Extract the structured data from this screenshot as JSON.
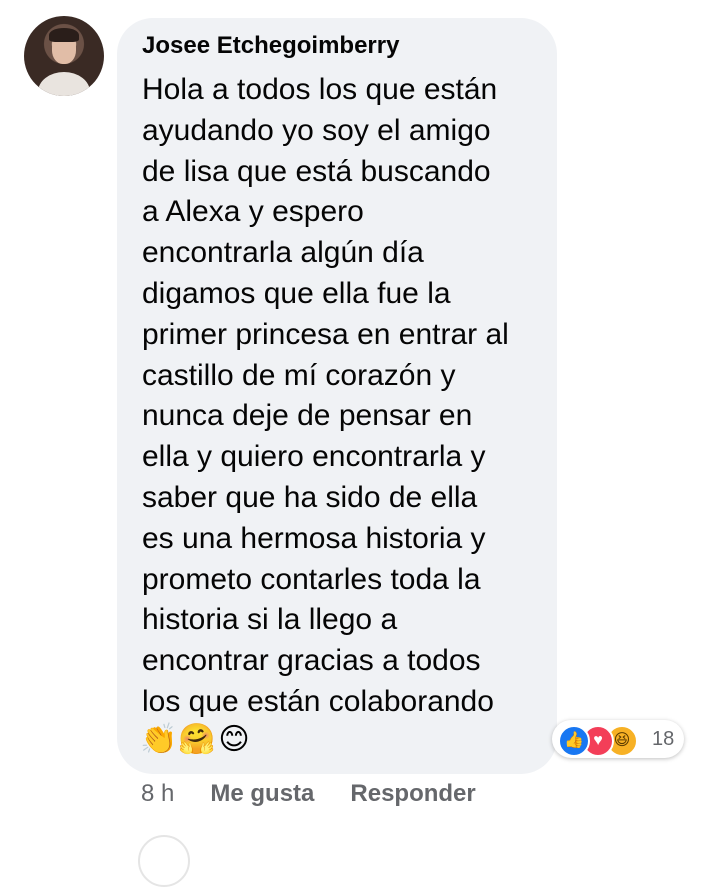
{
  "comment": {
    "author": "Josee Etchegoimberry",
    "lines": [
      "Hola a todos los que están",
      "ayudando yo soy el amigo",
      "de lisa que está buscando",
      "a Alexa y espero",
      "encontrarla algún día",
      "digamos que ella fue la",
      "primer princesa en entrar al",
      "castillo de mí corazón y",
      "nunca deje de pensar en",
      "ella y quiero encontrarla y",
      "saber que ha sido de ella",
      "es una hermosa historia y",
      "prometo contarles toda la",
      "historia si la llego a",
      "encontrar gracias a todos",
      "los que están colaborando"
    ],
    "emojis": [
      "👏",
      "🤗",
      "😊"
    ]
  },
  "reactions": {
    "icons": [
      "like",
      "love",
      "haha"
    ],
    "count": "18"
  },
  "actions": {
    "time": "8 h",
    "like": "Me gusta",
    "reply": "Responder"
  },
  "colors": {
    "bubble": "#f0f2f5",
    "text": "#050505",
    "meta": "#65676b",
    "like": "#1877f2",
    "love": "#f33e58",
    "haha": "#f7b125"
  }
}
